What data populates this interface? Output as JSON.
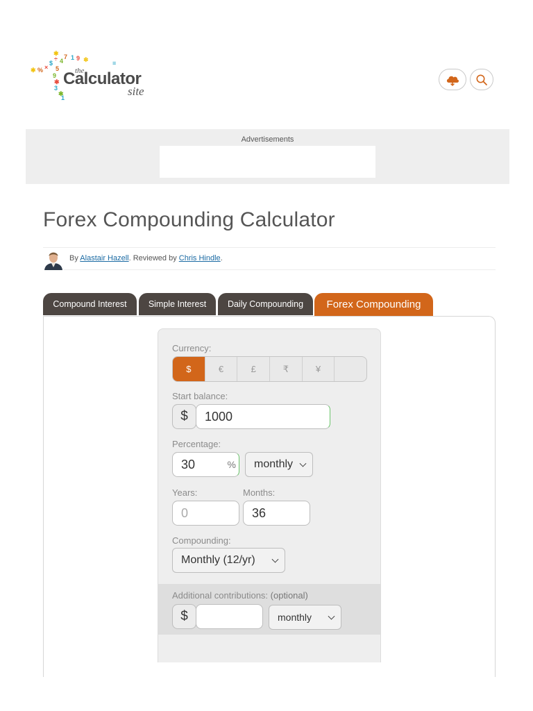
{
  "header": {
    "logo": {
      "the": "the",
      "calculator": "Calculator",
      "site": "site"
    },
    "cloud_button_icon": "cloud-icon",
    "search_button_icon": "search-icon",
    "accent_color": "#d2661a"
  },
  "ads": {
    "label": "Advertisements"
  },
  "page": {
    "title": "Forex Compounding Calculator"
  },
  "byline": {
    "by": "By ",
    "author": "Alastair Hazell",
    "reviewed": ". Reviewed by ",
    "reviewer": "Chris Hindle",
    "end": "."
  },
  "tabs": [
    {
      "label": "Compound Interest",
      "active": false
    },
    {
      "label": "Simple Interest",
      "active": false
    },
    {
      "label": "Daily Compounding",
      "active": false
    },
    {
      "label": "Forex Compounding",
      "active": true
    }
  ],
  "calculator": {
    "currency": {
      "label": "Currency:",
      "options": [
        "$",
        "€",
        "£",
        "₹",
        "¥",
        ""
      ],
      "selected": "$"
    },
    "start_balance": {
      "label": "Start balance:",
      "prefix": "$",
      "value": "1000"
    },
    "percentage": {
      "label": "Percentage:",
      "value": "30",
      "suffix": "%",
      "period": "monthly"
    },
    "years": {
      "label": "Years:",
      "placeholder": "0"
    },
    "months": {
      "label": "Months:",
      "value": "36"
    },
    "compounding": {
      "label": "Compounding:",
      "value": "Monthly (12/yr)"
    },
    "additional": {
      "label": "Additional contributions:",
      "optional": "(optional)",
      "prefix": "$",
      "value": "",
      "period": "monthly"
    }
  }
}
